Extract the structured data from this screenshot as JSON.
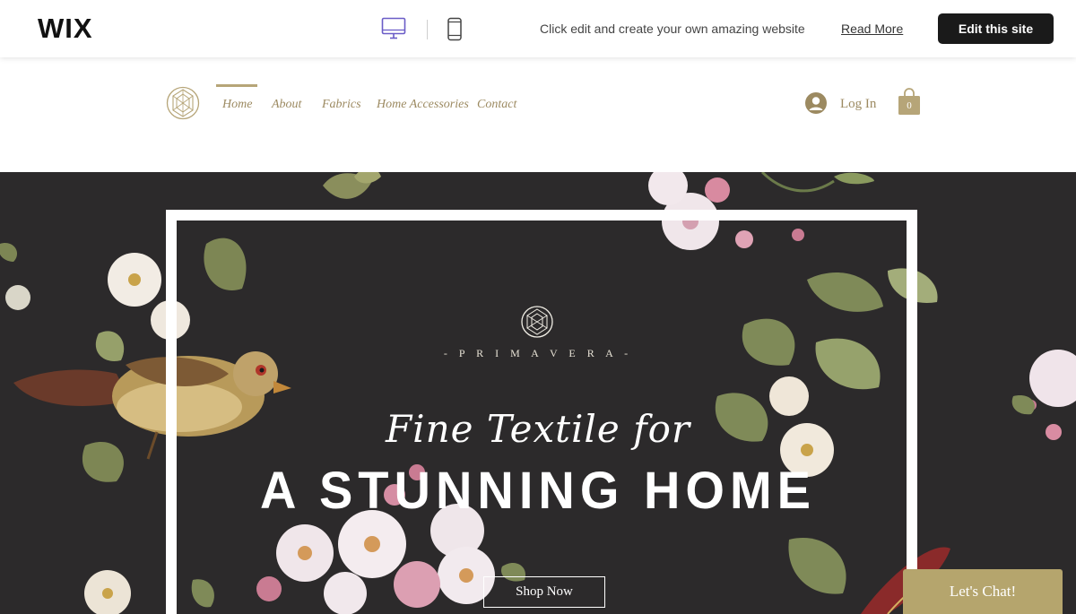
{
  "wix_bar": {
    "logo": "WIX",
    "promo_text": "Click edit and create your own amazing website",
    "read_more": "Read More",
    "edit_button": "Edit this site",
    "icons": [
      "desktop-icon",
      "mobile-icon"
    ]
  },
  "site_header": {
    "nav": [
      "Home",
      "About",
      "Fabrics",
      "Home Accessories",
      "Contact"
    ],
    "active_nav": "Home",
    "login": "Log In",
    "cart_count": "0",
    "icons": [
      "diamond-logo-icon",
      "user-avatar-icon",
      "shopping-bag-icon"
    ]
  },
  "hero": {
    "brand": "- P R I M A V E R A -",
    "script_line": "Fine Textile for",
    "title": "A STUNNING HOME",
    "shop_button": "Shop Now"
  },
  "chat": {
    "label": "Let's Chat!"
  },
  "colors": {
    "accent_gold": "#b6a578",
    "nav_text": "#9c8a61",
    "hero_bg": "#2c2a2b",
    "chat_bg": "#b5a56d",
    "edit_button_bg": "#1a1a1a"
  }
}
